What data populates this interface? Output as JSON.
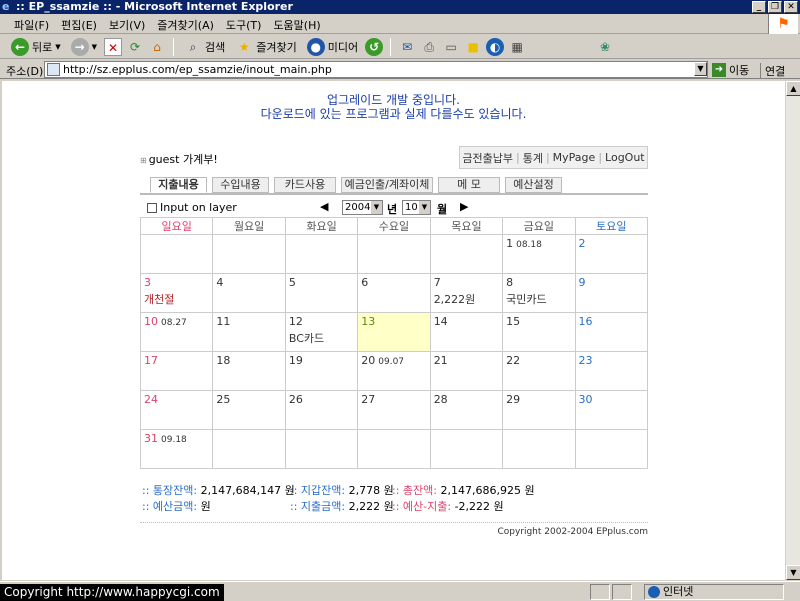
{
  "window": {
    "title": ":: EP_ssamzie :: - Microsoft Internet Explorer"
  },
  "menu": [
    "파일(F)",
    "편집(E)",
    "보기(V)",
    "즐겨찾기(A)",
    "도구(T)",
    "도움말(H)"
  ],
  "toolbar": {
    "back": "뒤로",
    "search": "검색",
    "favorites": "즐겨찾기",
    "media": "미디어"
  },
  "address": {
    "label": "주소(D)",
    "url": "http://sz.epplus.com/ep_ssamzie/inout_main.php",
    "go": "이동",
    "links": "연결"
  },
  "page": {
    "notice_line1": "업그레이드 개발 중입니다.",
    "notice_line2": "다운로드에 있는 프로그램과 실제 다를수도 있습니다.",
    "title": "guest 가계부!",
    "nav": [
      "금전출납부",
      "통계",
      "MyPage",
      "LogOut"
    ],
    "tabs": [
      "지출내용",
      "수입내용",
      "카드사용",
      "예금인출/계좌이체",
      "메 모",
      "예산설정"
    ],
    "input_on_layer": "Input on layer",
    "year": "2004",
    "year_label": "년",
    "month": "10",
    "month_label": "월",
    "prev": "◀",
    "next": "▶"
  },
  "calendar": {
    "weekdays": [
      "일요일",
      "월요일",
      "화요일",
      "수요일",
      "목요일",
      "금요일",
      "토요일"
    ],
    "weeks": [
      [
        {},
        {},
        {},
        {},
        {},
        {
          "d": "1",
          "lunar": "08.18"
        },
        {
          "d": "2"
        }
      ],
      [
        {
          "d": "3",
          "note": "개천절",
          "holiday": true
        },
        {
          "d": "4"
        },
        {
          "d": "5"
        },
        {
          "d": "6"
        },
        {
          "d": "7",
          "note": "2,222원"
        },
        {
          "d": "8",
          "note": "국민카드"
        },
        {
          "d": "9"
        }
      ],
      [
        {
          "d": "10",
          "lunar": "08.27"
        },
        {
          "d": "11"
        },
        {
          "d": "12",
          "note": "BC카드"
        },
        {
          "d": "13",
          "today": true
        },
        {
          "d": "14"
        },
        {
          "d": "15"
        },
        {
          "d": "16"
        }
      ],
      [
        {
          "d": "17"
        },
        {
          "d": "18"
        },
        {
          "d": "19"
        },
        {
          "d": "20",
          "lunar": "09.07"
        },
        {
          "d": "21"
        },
        {
          "d": "22"
        },
        {
          "d": "23"
        }
      ],
      [
        {
          "d": "24"
        },
        {
          "d": "25"
        },
        {
          "d": "26"
        },
        {
          "d": "27"
        },
        {
          "d": "28"
        },
        {
          "d": "29"
        },
        {
          "d": "30"
        }
      ],
      [
        {
          "d": "31",
          "lunar": "09.18"
        },
        {},
        {},
        {},
        {},
        {},
        {}
      ]
    ]
  },
  "summary": {
    "bankbook_label": ":: 통장잔액:",
    "bankbook_value": "2,147,684,147 원",
    "wallet_label": ":: 지갑잔액:",
    "wallet_value": "2,778 원",
    "total_label": ":: 총잔액:",
    "total_value": "2,147,686,925 원",
    "budget_label": ":: 예산금액:",
    "budget_value": "원",
    "expense_label": ":: 지출금액:",
    "expense_value": "2,222 원",
    "diff_label": ":: 예산-지출:",
    "diff_value": "-2,222 원"
  },
  "copyright": "Copyright 2002-2004 EPplus.com",
  "status": {
    "overlay": "Copyright  http://www.happycgi.com",
    "zone": "인터넷"
  }
}
